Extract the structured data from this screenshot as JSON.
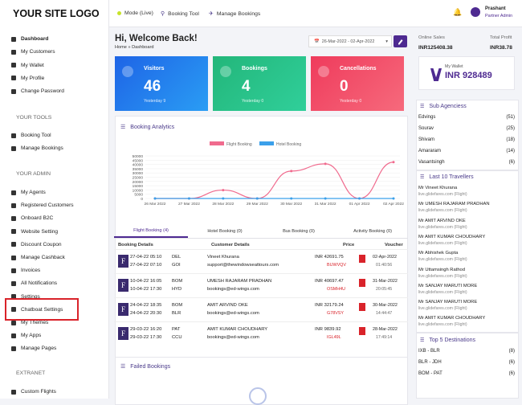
{
  "logo": "YOUR SITE LOGO",
  "sidebar": {
    "items1": [
      "Dashboard",
      "My Customers",
      "My Wallet",
      "My Profile",
      "Change Password"
    ],
    "tools_title": "YOUR TOOLS",
    "items2": [
      "Booking Tool",
      "Manage Bookings"
    ],
    "admin_title": "YOUR ADMIN",
    "items3": [
      "My Agents",
      "Registered Customers",
      "Onboard B2C",
      "Website Setting",
      "Discount Coupon",
      "Manage Cashback",
      "Invoices",
      "All Notifications",
      "Settings",
      "Chatboat Settings",
      "My Themes",
      "My Apps",
      "Manage Pages"
    ],
    "extranet_title": "EXTRANET",
    "items4": [
      "Custom Flights"
    ]
  },
  "topbar": {
    "mode": "Mode (Live)",
    "booking_tool": "Booking Tool",
    "manage_bookings": "Manage Bookings",
    "user_name": "Prashant",
    "user_role": "Partner Admin"
  },
  "main": {
    "welcome": "Hi, Welcome Back!",
    "breadcrumb": "Home » Dashboard",
    "date_range": "26-Mar-2022 - 02-Apr-2022",
    "cards": [
      {
        "title": "Visitors",
        "value": "46",
        "sub": "Yesterday 9"
      },
      {
        "title": "Bookings",
        "value": "4",
        "sub": "Yesterday 0"
      },
      {
        "title": "Cancellations",
        "value": "0",
        "sub": "Yesterday 0"
      }
    ],
    "analytics_title": "Booking Analytics",
    "tabs": [
      "Flight Booking (4)",
      "Hotel Booking (0)",
      "Bus Booking (0)",
      "Activity Booking (0)"
    ],
    "table_headers": [
      "Booking Details",
      "Customer Details",
      "Price",
      "Voucher"
    ],
    "rows": [
      {
        "d1": "27-04-22 05:10",
        "d2": "27-04-22 07:10",
        "a1": "DEL",
        "a2": "GOI",
        "name": "Vineet Khurana",
        "email": "support@thewindowseattours.com",
        "price": "INR 42691.75",
        "pnr": "BUWVQV",
        "vdate": "02-Apr-2022",
        "vtime": "01:40:56"
      },
      {
        "d1": "10-04-22 16:05",
        "d2": "10-04-22 17:30",
        "a1": "BOM",
        "a2": "HYD",
        "name": "UMESH RAJARAM PRADHAN",
        "email": "bookings@ed-wings.com",
        "price": "INR 40697.47",
        "pnr": "OSMH4U",
        "vdate": "31-Mar-2022",
        "vtime": "20:05:45"
      },
      {
        "d1": "24-04-22 18:35",
        "d2": "24-04-22 20:30",
        "a1": "BOM",
        "a2": "BLR",
        "name": "AMIT ARVIND OKE",
        "email": "bookings@ed-wings.com",
        "price": "INR 32179.24",
        "pnr": "G78VSY",
        "vdate": "30-Mar-2022",
        "vtime": "14:44:47"
      },
      {
        "d1": "29-03-22 16:20",
        "d2": "29-03-22 17:30",
        "a1": "PAT",
        "a2": "CCU",
        "name": "AMIT KUMAR CHOUDHARY",
        "email": "bookings@ed-wings.com",
        "price": "INR 9839.92",
        "pnr": "IGL49L",
        "vdate": "28-Mar-2022",
        "vtime": "17:49:14"
      }
    ],
    "failed_title": "Failed Bookings"
  },
  "chart_data": {
    "type": "line",
    "x": [
      "26 Mar 2022",
      "27 Mar 2022",
      "28 Mar 2022",
      "29 Mar 2022",
      "30 Mar 2022",
      "31 Mar 2022",
      "01 Apr 2022",
      "02 Apr 2022"
    ],
    "series": [
      {
        "name": "Flight Booking",
        "color": "#f06b8e",
        "values": [
          0,
          0,
          9839,
          0,
          32179,
          40697,
          0,
          42691
        ]
      },
      {
        "name": "Hotel Booking",
        "color": "#3ba0ea",
        "values": [
          0,
          0,
          0,
          0,
          0,
          0,
          0,
          0
        ]
      }
    ],
    "yticks": [
      "0",
      "5000",
      "10000",
      "15000",
      "20000",
      "25000",
      "30000",
      "35000",
      "40000",
      "45000",
      "50000"
    ],
    "ylim": [
      0,
      50000
    ]
  },
  "right": {
    "online_sales_label": "Online Sales",
    "online_sales": "INR125408.38",
    "total_profit_label": "Total Profit",
    "total_profit": "INR38.78",
    "wallet_label": "My Wallet",
    "wallet_value": "INR 928489",
    "subagencies_title": "Sub Agenciess",
    "subagencies": [
      {
        "name": "Edvings",
        "count": "(51)"
      },
      {
        "name": "Sourav",
        "count": "(25)"
      },
      {
        "name": "Shivam",
        "count": "(18)"
      },
      {
        "name": "Amararam",
        "count": "(14)"
      },
      {
        "name": "Vasantsingh",
        "count": "(6)"
      }
    ],
    "travellers_title": "Last 10 Travellers",
    "travellers": [
      {
        "name": "Mr Vineet Khurana",
        "sub": "live.glidefares.com (Flight)"
      },
      {
        "name": "Mr UMESH RAJARAM PRADHAN",
        "sub": "live.glidefares.com (Flight)"
      },
      {
        "name": "Mr AMIT ARVIND OKE",
        "sub": "live.glidefares.com (Flight)"
      },
      {
        "name": "Mr AMIT KUMAR CHOUDHARY",
        "sub": "live.glidefares.com (Flight)"
      },
      {
        "name": "Mr Abhishek Gupta",
        "sub": "live.glidefares.com (Flight)"
      },
      {
        "name": "Mr Uttamsingh Rathod",
        "sub": "live.glidefares.com (Flight)"
      },
      {
        "name": "Mr SANJAY MARUTI MORE",
        "sub": "live.glidefares.com (Flight)"
      },
      {
        "name": "Mr SANJAY MARUTI MORE",
        "sub": "live.glidefares.com (Flight)"
      },
      {
        "name": "Mr AMIT KUMAR CHOUDHARY",
        "sub": "live.glidefares.com (Flight)"
      }
    ],
    "destinations_title": "Top 5 Destinations",
    "destinations": [
      {
        "name": "IXB - BLR",
        "count": "(8)"
      },
      {
        "name": "BLR - JDH",
        "count": "(6)"
      },
      {
        "name": "BOM - PAT",
        "count": "(6)"
      }
    ]
  }
}
